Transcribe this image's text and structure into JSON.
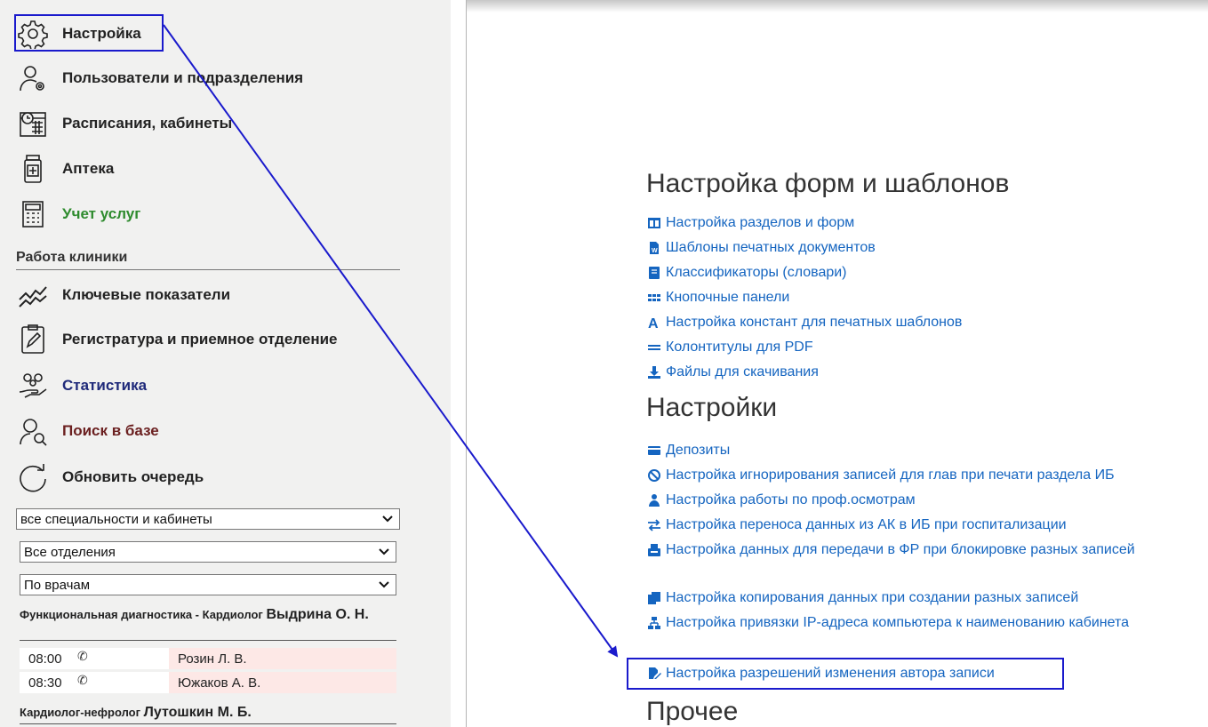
{
  "sidebar": {
    "nav": [
      {
        "label": "Настройка",
        "icon": "gear-icon"
      },
      {
        "label": "Пользователи и подразделения",
        "icon": "user-settings-icon"
      },
      {
        "label": "Расписания, кабинеты",
        "icon": "calendar-clock-icon"
      },
      {
        "label": "Аптека",
        "icon": "medicine-jar-icon"
      },
      {
        "label": "Учет услуг",
        "icon": "calculator-icon",
        "color": "#2e8b2e"
      }
    ],
    "section_title": "Работа клиники",
    "clinic": [
      {
        "label": "Ключевые показатели",
        "icon": "trend-lines-icon"
      },
      {
        "label": "Регистратура и приемное отделение",
        "icon": "clipboard-icon"
      },
      {
        "label": "Статистика",
        "icon": "statistics-hand-icon",
        "color": "#1f2a7a"
      },
      {
        "label": "Поиск в базе",
        "icon": "user-search-icon",
        "color": "#6b2020"
      },
      {
        "label": "Обновить очередь",
        "icon": "refresh-icon"
      }
    ],
    "filters": {
      "specialty": "все специальности и кабинеты",
      "department": "Все отделения",
      "grouping": "По врачам"
    },
    "queues": [
      {
        "header_small": "Функциональная диагностика - Кардиолог ",
        "header_big": "Выдрина О. Н.",
        "appointments": [
          {
            "time": "08:00",
            "phone_icon": "phone-icon",
            "patient": "Розин Л. В."
          },
          {
            "time": "08:30",
            "phone_icon": "phone-icon",
            "patient": "Южаков А. В."
          }
        ]
      },
      {
        "header_small": "Кардиолог-нефролог ",
        "header_big": "Лутошкин М. Б.",
        "appointments": []
      }
    ]
  },
  "main": {
    "groups": [
      {
        "title": "Настройка форм и шаблонов",
        "links": [
          {
            "label": "Настройка разделов и форм",
            "icon": "columns-icon"
          },
          {
            "label": "Шаблоны печатных документов",
            "icon": "word-document-icon"
          },
          {
            "label": "Классификаторы (словари)",
            "icon": "book-icon"
          },
          {
            "label": "Кнопочные панели",
            "icon": "grid-dots-icon"
          },
          {
            "label": "Настройка констант для печатных шаблонов",
            "icon": "font-a-icon"
          },
          {
            "label": "Колонтитулы для PDF",
            "icon": "equals-icon"
          },
          {
            "label": "Файлы для скачивания",
            "icon": "download-icon"
          }
        ]
      },
      {
        "title": "Настройки",
        "links": [
          {
            "label": "Депозиты",
            "icon": "credit-card-icon"
          },
          {
            "label": "Настройка игнорирования записей для глав при печати раздела ИБ",
            "icon": "ban-icon"
          },
          {
            "label": "Настройка работы по проф.осмотрам",
            "icon": "medical-person-icon"
          },
          {
            "label": "Настройка переноса данных из АК в ИБ при госпитализации",
            "icon": "exchange-arrows-icon"
          },
          {
            "label": "Настройка данных для передачи в ФР при блокировке разных записей",
            "icon": "fax-icon"
          },
          {
            "label": "Настройка копирования данных при создании разных записей",
            "icon": "copy-icon"
          },
          {
            "label": "Настройка привязки IP-адреса компьютера к наименованию кабинета",
            "icon": "network-icon"
          },
          {
            "label": "Настройка разрешений изменения автора записи",
            "icon": "file-signature-icon"
          }
        ]
      },
      {
        "title": "Прочее",
        "links": []
      }
    ]
  },
  "annotation": {
    "color": "#1a1acc",
    "from": "sidebar-item-nastroika",
    "to": "link-author-permissions"
  }
}
